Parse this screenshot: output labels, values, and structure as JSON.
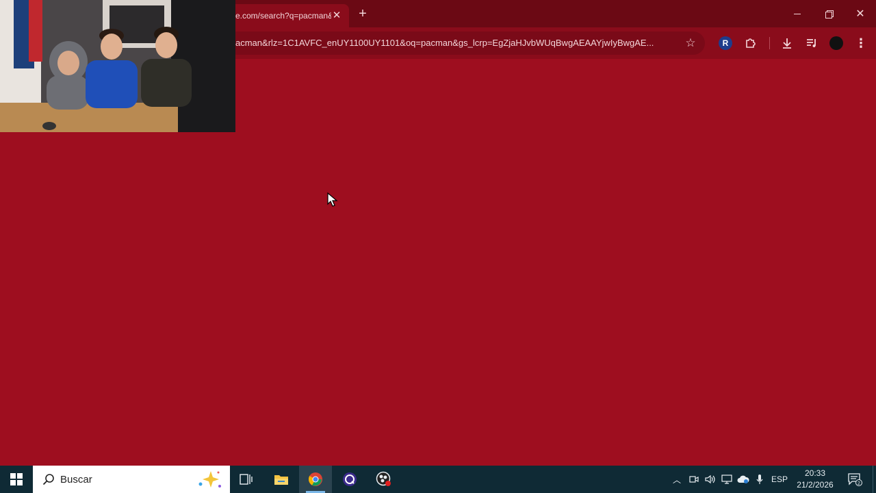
{
  "browser": {
    "tab": {
      "title": "e.com/search?q=pacman&rlz="
    },
    "address_bar": {
      "url": "acman&rlz=1C1AVFC_enUY1100UY1101&oq=pacman&gs_lcrp=EgZjaHJvbWUqBwgAEAAYjwIyBwgAE..."
    },
    "extension_badge": "R",
    "theme_color": "#9e0e1f"
  },
  "taskbar": {
    "search_placeholder": "Buscar",
    "language": "ESP",
    "time": "20:33",
    "date": "21/2/2026",
    "notification_count": "2",
    "background_color": "#0f2a35"
  }
}
